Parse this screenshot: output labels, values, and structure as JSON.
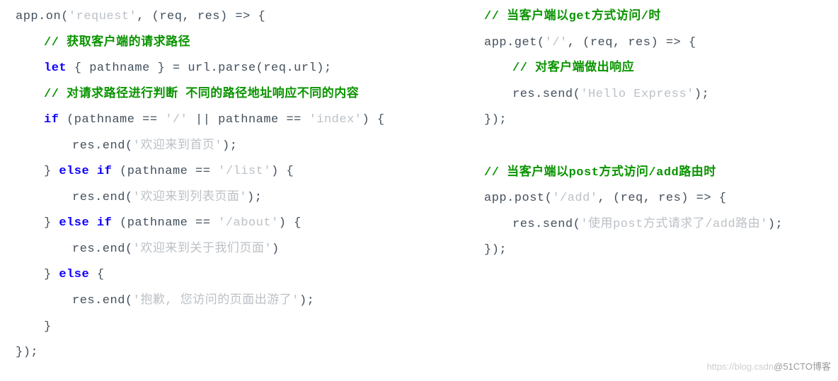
{
  "left": {
    "l1": {
      "a": "app.on(",
      "b": "'request'",
      "c": ", (req, res) => {"
    },
    "l2": "// 获取客户端的请求路径",
    "l3": {
      "a": "let",
      "b": " { pathname } = url.parse(req.url);"
    },
    "l4": "// 对请求路径进行判断 不同的路径地址响应不同的内容",
    "l5": {
      "a": "if",
      "b": " (pathname == ",
      "c": "'/'",
      "d": " || pathname == ",
      "e": "'index'",
      "f": ") {"
    },
    "l6": {
      "a": "res.end(",
      "b": "'欢迎来到首页'",
      "c": ");"
    },
    "l7": {
      "a": "} ",
      "b": "else if",
      "c": " (pathname == ",
      "d": "'/list'",
      "e": ") {"
    },
    "l8": {
      "a": "res.end(",
      "b": "'欢迎来到列表页面'",
      "c": ");"
    },
    "l9": {
      "a": "} ",
      "b": "else if",
      "c": " (pathname == ",
      "d": "'/about'",
      "e": ") {"
    },
    "l10": {
      "a": "res.end(",
      "b": "'欢迎来到关于我们页面'",
      "c": ")"
    },
    "l11": {
      "a": "} ",
      "b": "else",
      "c": " {"
    },
    "l12": {
      "a": "res.end(",
      "b": "'抱歉, 您访问的页面出游了'",
      "c": ");"
    },
    "l13": "}",
    "l14": "});"
  },
  "right": {
    "r1": "// 当客户端以get方式访问/时",
    "r2": {
      "a": "app.get(",
      "b": "'/'",
      "c": ", (req, res) => {"
    },
    "r3": "// 对客户端做出响应",
    "r4": {
      "a": "res.send(",
      "b": "'Hello Express'",
      "c": ");"
    },
    "r5": "});",
    "r6": "// 当客户端以post方式访问/add路由时",
    "r7": {
      "a": "app.post(",
      "b": "'/add'",
      "c": ", (req, res) => {"
    },
    "r8": {
      "a": "res.send(",
      "b": "'使用post方式请求了/add路由'",
      "c": ");"
    },
    "r9": "});"
  },
  "watermark": {
    "a": "https://blog.csdn",
    "b": "@51CTO博客"
  }
}
